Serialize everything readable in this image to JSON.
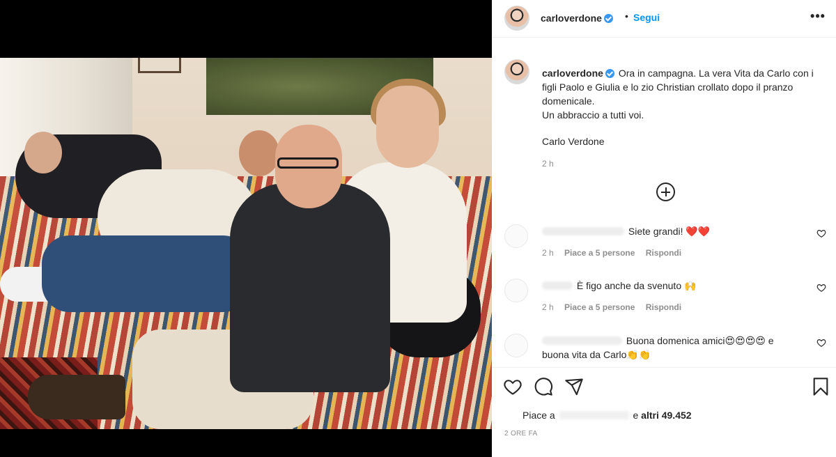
{
  "post": {
    "username": "carloverdone",
    "follow_label": "Segui",
    "separator": "•",
    "more_label": "•••",
    "caption_username": "carloverdone",
    "caption_lines": [
      "Ora in campagna. La vera Vita da Carlo con i figli Paolo e Giulia e lo zio Christian crollato dopo il pranzo domenicale.",
      "Un abbraccio a tutti voi."
    ],
    "caption_signature": "Carlo Verdone",
    "caption_time": "2 h"
  },
  "comments": [
    {
      "text": "Siete grandi! ❤️❤️",
      "time": "2 h",
      "likes": "Piace a 5 persone",
      "reply": "Rispondi"
    },
    {
      "text": "È figo anche da svenuto 🙌",
      "time": "2 h",
      "likes": "Piace a 5 persone",
      "reply": "Rispondi"
    },
    {
      "text": "Buona domenica amici😍😍😍😍 e buona vita da Carlo👏👏"
    }
  ],
  "likes": {
    "prefix": "Piace a",
    "middle": "e",
    "count": "altri 49.452"
  },
  "time_ago": "2 ORE FA",
  "icons": {
    "like": "heart-icon",
    "comment": "comment-icon",
    "share": "send-icon",
    "save": "bookmark-icon",
    "load_more": "plus-circle-icon"
  },
  "colors": {
    "link": "#0095f6",
    "verified": "#3897f0",
    "secondary_text": "#8e8e8e"
  }
}
